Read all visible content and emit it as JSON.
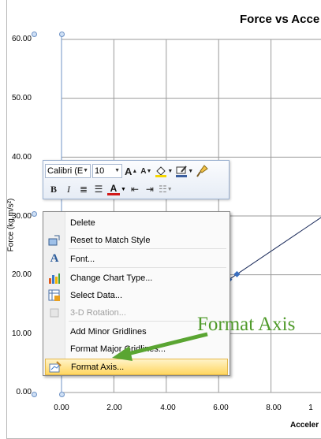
{
  "chart": {
    "title": "Force vs Acce",
    "ylabel": "Force (kg m/s²)",
    "xlabel": "Acceler",
    "yticks": [
      "60.00",
      "50.00",
      "40.00",
      "30.00",
      "20.00",
      "10.00",
      "0.00"
    ],
    "xticks": [
      "0.00",
      "2.00",
      "4.00",
      "6.00",
      "8.00",
      "1"
    ]
  },
  "chart_data": {
    "type": "scatter",
    "title": "Force vs Acce",
    "xlabel": "Acceler",
    "ylabel": "Force (kg m/s²)",
    "xlim": [
      0,
      10
    ],
    "ylim": [
      0,
      60
    ],
    "grid": true,
    "series": [
      {
        "x": [
          6.4,
          6.7
        ],
        "y": [
          19.2,
          20.1
        ]
      }
    ],
    "trendline": {
      "x": [
        6.0,
        10.0
      ],
      "y": [
        18.0,
        30.0
      ]
    }
  },
  "mini_toolbar": {
    "font_name": "Calibri (E",
    "font_size": "10",
    "grow_font": "A",
    "shrink_font": "A",
    "bold": "B",
    "italic": "I",
    "font_color": "A"
  },
  "context_menu": {
    "items": [
      {
        "label": "Delete",
        "icon": "delete-icon",
        "enabled": true
      },
      {
        "label": "Reset to Match Style",
        "icon": "reset-style-icon",
        "enabled": true
      },
      {
        "label": "Font...",
        "icon": "font-icon",
        "enabled": true
      },
      {
        "label": "Change Chart Type...",
        "icon": "chart-type-icon",
        "enabled": true
      },
      {
        "label": "Select Data...",
        "icon": "select-data-icon",
        "enabled": true
      },
      {
        "label": "3-D Rotation...",
        "icon": "rotation-icon",
        "enabled": false
      },
      {
        "label": "Add Minor Gridlines",
        "icon": "",
        "enabled": true
      },
      {
        "label": "Format Major Gridlines...",
        "icon": "",
        "enabled": true
      },
      {
        "label": "Format Axis...",
        "icon": "format-axis-icon",
        "enabled": true,
        "highlighted": true
      }
    ]
  },
  "annotation": {
    "text": "Format Axis",
    "color": "#4f9a2a"
  }
}
